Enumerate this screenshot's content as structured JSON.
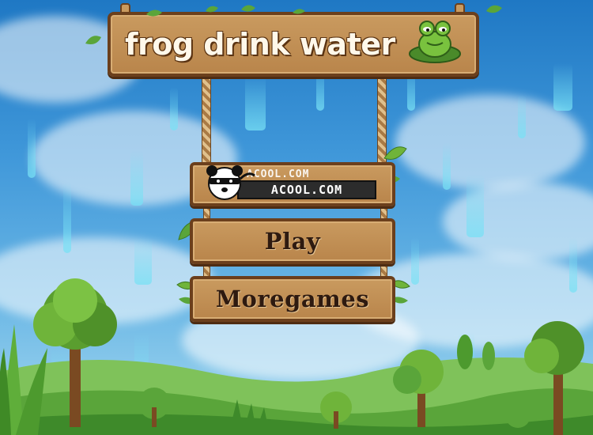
{
  "game": {
    "title": "frog drink water",
    "logo": {
      "text": "ACOOL.COM",
      "echo": "ACOOL.COM"
    },
    "menu": {
      "play_label": "Play",
      "moregames_label": "Moregames"
    }
  },
  "colors": {
    "sky_top": "#1f78c4",
    "sky_bottom": "#a6d9ef",
    "wood": "#c99a5f",
    "wood_border": "#6b3f1c",
    "label_text": "#2e1a10",
    "title_text": "#fff8ea",
    "grass": "#5aa53a"
  },
  "icons": [
    "frog-icon",
    "panda-icon",
    "leaf-icon",
    "rope-icon",
    "tree-icon"
  ]
}
